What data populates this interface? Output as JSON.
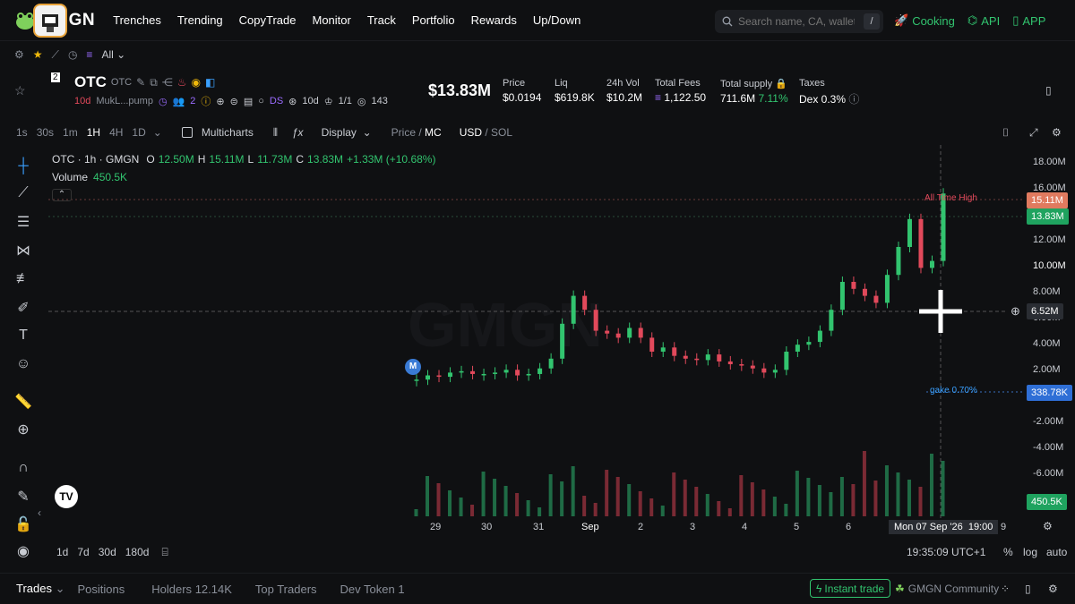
{
  "nav": {
    "brand": "GMGN",
    "links": [
      "Trenches",
      "Trending",
      "CopyTrade",
      "Monitor",
      "Track",
      "Portfolio",
      "Rewards",
      "Up/Down"
    ],
    "search_placeholder": "Search name, CA, wallet",
    "search_shortcut": "/",
    "cooking": "Cooking",
    "api": "API",
    "app": "APP"
  },
  "filter": {
    "all": "All"
  },
  "token": {
    "symbol": "OTC",
    "ticker": "OTC",
    "age": "10d",
    "address": "MukL...pump",
    "holders_small": "2",
    "ds": "DS",
    "dev_age": "10d",
    "dev_ratio": "1/1",
    "views": "143",
    "market_cap": "$13.83M",
    "avatar_badge": "2",
    "stats": [
      {
        "label": "Price",
        "value": "$0.0194"
      },
      {
        "label": "Liq",
        "value": "$619.8K"
      },
      {
        "label": "24h Vol",
        "value": "$10.2M"
      },
      {
        "label": "Total Fees",
        "value": "1,122.50"
      },
      {
        "label": "Total supply",
        "value": "711.6M",
        "extra": "7.11%"
      },
      {
        "label": "Taxes",
        "value": "Dex 0.3%"
      }
    ]
  },
  "toolbar": {
    "intervals": [
      "1s",
      "30s",
      "1m",
      "1H",
      "4H",
      "1D"
    ],
    "active_interval": "1H",
    "multicharts": "Multicharts",
    "display": "Display",
    "price": "Price",
    "mc": "MC",
    "usd": "USD",
    "sol": "SOL"
  },
  "legend": {
    "title": "OTC · 1h · GMGN",
    "o_label": "O",
    "o": "12.50M",
    "h_label": "H",
    "h": "15.11M",
    "l_label": "L",
    "l": "11.73M",
    "c_label": "C",
    "c": "13.83M",
    "change": "+1.33M (+10.68%)",
    "volume_label": "Volume",
    "volume": "450.5K"
  },
  "chart_data": {
    "type": "line",
    "price_axis": [
      "18.00M",
      "16.00M",
      "12.00M",
      "10.00M",
      "8.00M",
      "6.00M",
      "4.00M",
      "2.00M",
      "-2.00M",
      "-4.00M",
      "-6.00M"
    ],
    "x_ticks": [
      "29",
      "30",
      "31",
      "Sep",
      "2",
      "3",
      "4",
      "5",
      "6",
      "9"
    ],
    "series": [
      {
        "values": [
          0.5,
          0.8,
          0.7,
          1.0,
          1.1,
          0.9,
          0.9,
          1.0,
          1.2,
          0.8,
          0.9,
          1.3,
          2.0,
          4.5,
          6.5,
          5.5,
          4.0,
          3.8,
          3.5,
          4.2,
          3.5,
          2.5,
          2.8,
          2.2,
          2.0,
          1.9,
          2.3,
          1.8,
          1.6,
          1.5,
          1.3,
          1.0,
          1.2,
          2.5,
          3.0,
          3.2,
          4.0,
          5.5,
          7.5,
          7.0,
          6.5,
          6.0,
          8.0,
          10.0,
          12.0,
          8.5,
          9.0,
          13.83
        ]
      }
    ],
    "markers": {
      "all_time_high": "All Time High",
      "ath_value": "15.11M",
      "current": "13.83M",
      "crosshair": "6.52M",
      "gake": "gake 0.70%",
      "gake_value": "338.78K",
      "volume_value": "450.5K"
    },
    "crosshair_time": "Mon 07 Sep '26  19:00"
  },
  "bottom": {
    "ranges": [
      "1d",
      "7d",
      "30d",
      "180d"
    ],
    "time": "19:35:09 UTC+1",
    "pct": "%",
    "log": "log",
    "auto": "auto"
  },
  "tabs": {
    "trades": "Trades",
    "positions": "Positions",
    "holders": "Holders",
    "holders_count": "12.14K",
    "top_traders": "Top Traders",
    "dev_token": "Dev Token",
    "dev_token_count": "1",
    "instant_trade": "Instant trade",
    "community": "GMGN Community"
  }
}
